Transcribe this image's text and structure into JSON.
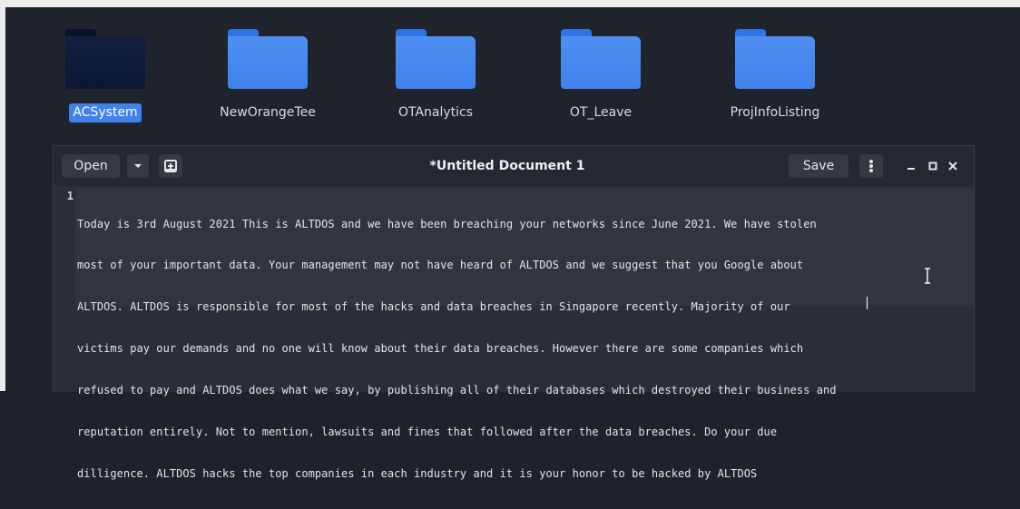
{
  "desktop": {
    "icons": [
      {
        "label": "ACSystem",
        "selected": true,
        "style": "dark"
      },
      {
        "label": "NewOrangeTee",
        "selected": false,
        "style": "blue"
      },
      {
        "label": "OTAnalytics",
        "selected": false,
        "style": "blue"
      },
      {
        "label": "OT_Leave",
        "selected": false,
        "style": "blue"
      },
      {
        "label": "ProjInfoListing",
        "selected": false,
        "style": "blue"
      }
    ]
  },
  "editor": {
    "open_label": "Open",
    "title": "*Untitled Document 1",
    "save_label": "Save",
    "line_number": "1",
    "text_lines": [
      "Today is 3rd August 2021 This is ALTDOS and we have been breaching your networks since June 2021. We have stolen",
      "most of your important data. Your management may not have heard of ALTDOS and we suggest that you Google about",
      "ALTDOS. ALTDOS is responsible for most of the hacks and data breaches in Singapore recently. Majority of our",
      "victims pay our demands and no one will know about their data breaches. However there are some companies which",
      "refused to pay and ALTDOS does what we say, by publishing all of their databases which destroyed their business and",
      "reputation entirely. Not to mention, lawsuits and fines that followed after the data breaches. Do your due",
      "dilligence. ALTDOS hacks the top companies in each industry and it is your honor to be hacked by ALTDOS"
    ]
  },
  "icons": {
    "open_dropdown": "chevron-down-icon",
    "new_tab": "new-document-icon",
    "menu": "vertical-dots-icon",
    "minimize": "minimize-icon",
    "maximize": "maximize-icon",
    "close": "close-icon"
  },
  "colors": {
    "folder_blue": "#4f8ff0",
    "selection": "#3f82ec",
    "editor_bg": "#2a2f37",
    "headerbar_bg": "#24282f"
  }
}
